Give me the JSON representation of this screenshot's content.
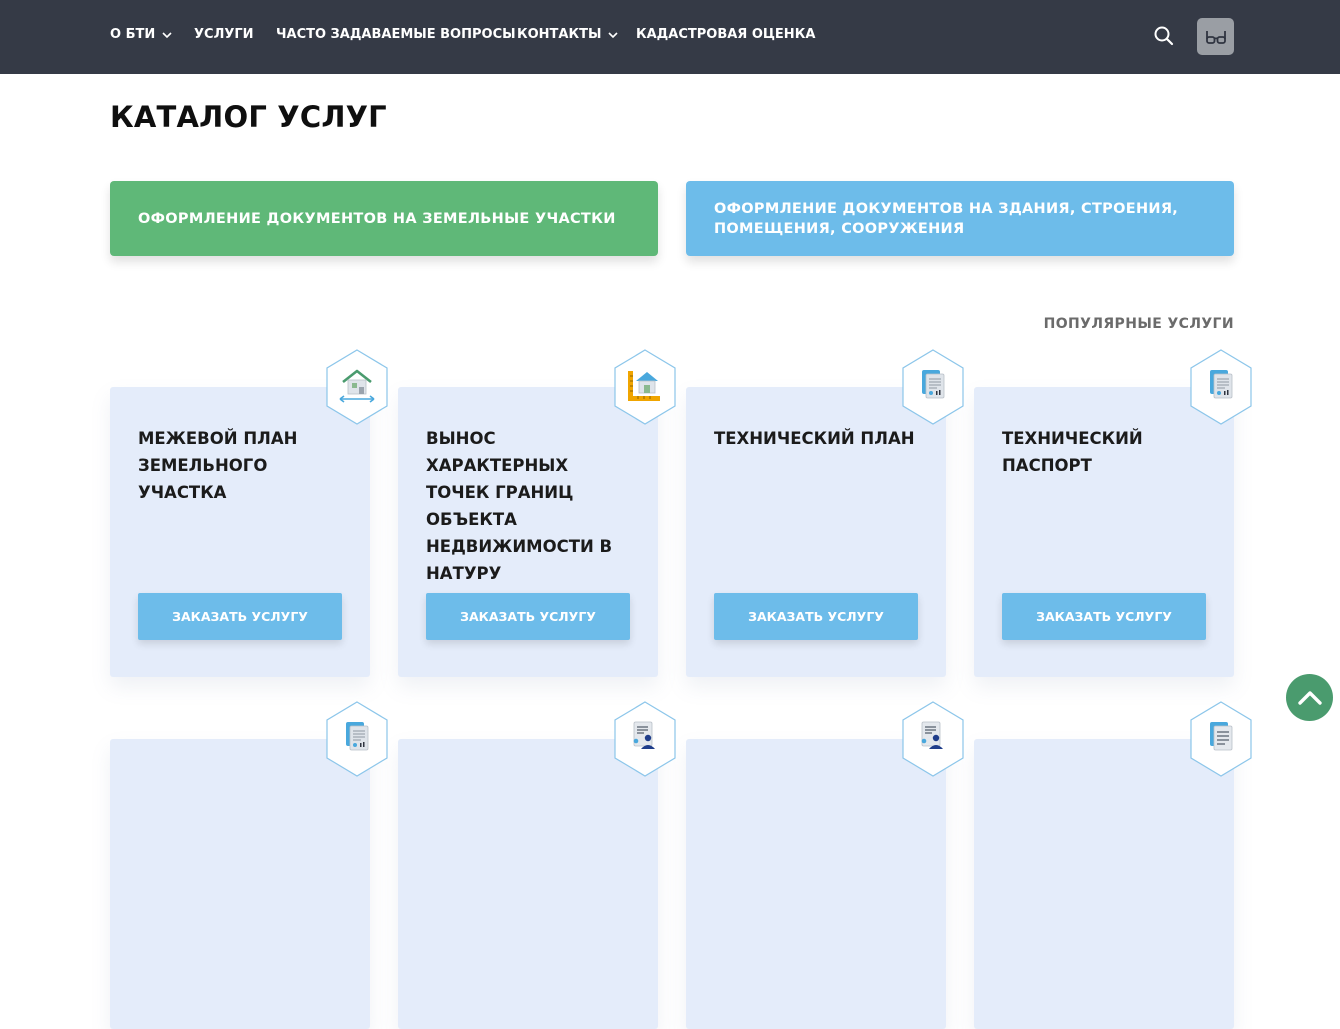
{
  "nav": {
    "items": [
      {
        "label": "О БТИ",
        "has_dropdown": true
      },
      {
        "label": "УСЛУГИ",
        "has_dropdown": false
      },
      {
        "label": "ЧАСТО ЗАДАВАЕМЫЕ ВОПРОСЫ",
        "has_dropdown": false
      },
      {
        "label": "КОНТАКТЫ",
        "has_dropdown": true
      },
      {
        "label": "КАДАСТРОВАЯ ОЦЕНКА",
        "has_dropdown": false
      }
    ],
    "search_icon": "search-icon",
    "accessibility_icon": "glasses-icon"
  },
  "page": {
    "title": "КАТАЛОГ УСЛУГ"
  },
  "categories": [
    {
      "label": "ОФОРМЛЕНИЕ ДОКУМЕНТОВ НА ЗЕМЕЛЬНЫЕ УЧАСТКИ",
      "color": "#5fb878"
    },
    {
      "label": "ОФОРМЛЕНИЕ ДОКУМЕНТОВ НА ЗДАНИЯ, СТРОЕНИЯ, ПОМЕЩЕНИЯ, СООРУЖЕНИЯ",
      "color": "#6dbcea"
    }
  ],
  "popular": {
    "label": "ПОПУЛЯРНЫЕ УСЛУГИ"
  },
  "cards": [
    {
      "title": "МЕЖЕВОЙ ПЛАН ЗЕМЕЛЬНОГО УЧАСТКА",
      "button": "ЗАКАЗАТЬ УСЛУГУ",
      "icon": "house-boundary-icon"
    },
    {
      "title": "ВЫНОС ХАРАКТЕРНЫХ ТОЧЕК ГРАНИЦ ОБЪЕКТА НЕДВИЖИМОСТИ В НАТУРУ",
      "button": "ЗАКАЗАТЬ УСЛУГУ",
      "icon": "house-ruler-icon"
    },
    {
      "title": "ТЕХНИЧЕСКИЙ ПЛАН",
      "button": "ЗАКАЗАТЬ УСЛУГУ",
      "icon": "document-chart-icon"
    },
    {
      "title": "ТЕХНИЧЕСКИЙ ПАСПОРТ",
      "button": "ЗАКАЗАТЬ УСЛУГУ",
      "icon": "document-chart-icon"
    }
  ],
  "second_row_icons": [
    "document-chart-icon",
    "document-person-icon",
    "document-person-icon",
    "document-lines-icon"
  ],
  "colors": {
    "header_bg": "#353a46",
    "land_green": "#5fb878",
    "accent_blue": "#6dbcea",
    "card_bg": "#e4ecfa",
    "scroll_top": "#4a9b6e"
  },
  "scroll_top_icon": "chevron-up-icon"
}
